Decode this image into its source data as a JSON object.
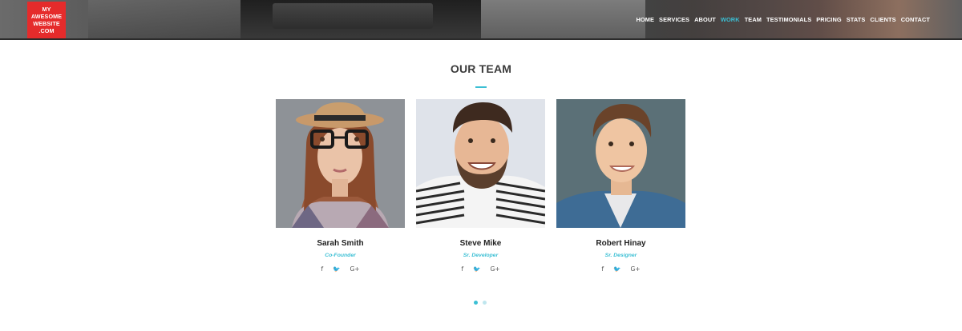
{
  "logo": {
    "lines": [
      "MY",
      "AWESOME",
      "WEBSITE",
      ".COM"
    ]
  },
  "nav": {
    "items": [
      {
        "label": "HOME",
        "active": false
      },
      {
        "label": "SERVICES",
        "active": false
      },
      {
        "label": "ABOUT",
        "active": false
      },
      {
        "label": "WORK",
        "active": true
      },
      {
        "label": "TEAM",
        "active": false
      },
      {
        "label": "TESTIMONIALS",
        "active": false
      },
      {
        "label": "PRICING",
        "active": false
      },
      {
        "label": "STATS",
        "active": false
      },
      {
        "label": "CLIENTS",
        "active": false
      },
      {
        "label": "CONTACT",
        "active": false
      }
    ]
  },
  "section": {
    "title": "OUR TEAM"
  },
  "team": [
    {
      "name": "Sarah Smith",
      "role": "Co-Founder"
    },
    {
      "name": "Steve Mike",
      "role": "Sr. Developer"
    },
    {
      "name": "Robert Hinay",
      "role": "Sr. Designer"
    }
  ],
  "social_icons": [
    "f",
    "🐦",
    "G+"
  ],
  "colors": {
    "accent": "#3bbfd4",
    "logo_bg": "#e52b2b"
  },
  "carousel": {
    "pages": 2,
    "active": 1
  }
}
